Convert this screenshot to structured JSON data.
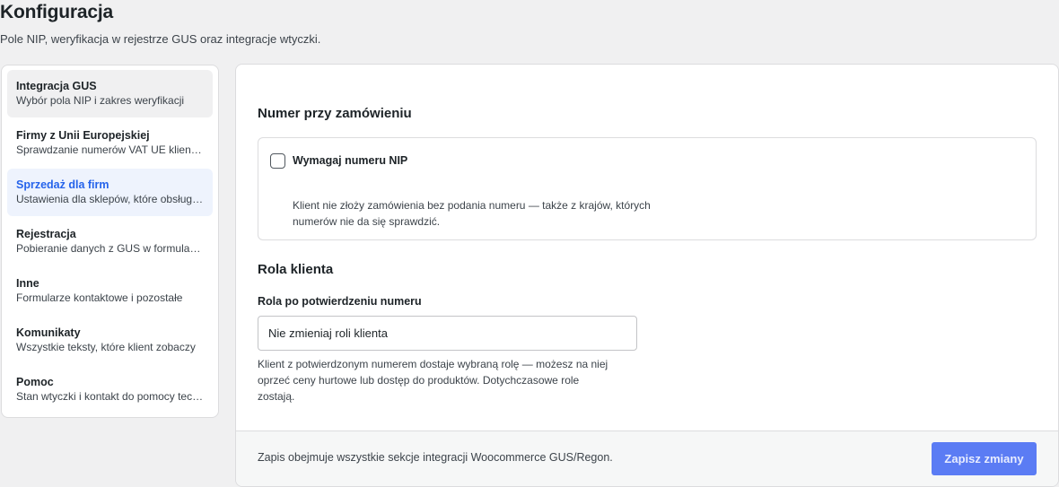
{
  "header": {
    "title": "Konfiguracja",
    "subtitle": "Pole NIP, weryfikacja w rejestrze GUS oraz integracje wtyczki."
  },
  "sidebar": {
    "items": [
      {
        "label": "Integracja GUS",
        "desc": "Wybór pola NIP i zakres weryfikacji"
      },
      {
        "label": "Firmy z Unii Europejskiej",
        "desc": "Sprawdzanie numerów VAT UE klientów"
      },
      {
        "label": "Sprzedaż dla firm",
        "desc": "Ustawienia dla sklepów, które obsługują"
      },
      {
        "label": "Rejestracja",
        "desc": "Pobieranie danych z GUS w formularzu"
      },
      {
        "label": "Inne",
        "desc": "Formularze kontaktowe i pozostałe"
      },
      {
        "label": "Komunikaty",
        "desc": "Wszystkie teksty, które klient zobaczy"
      },
      {
        "label": "Pomoc",
        "desc": "Stan wtyczki i kontakt do pomocy technicznej"
      }
    ],
    "active_index": 2
  },
  "main": {
    "order_section": {
      "title": "Numer przy zamówieniu",
      "checkbox_label": "Wymagaj numeru NIP",
      "checked": false,
      "help": "Klient nie złoży zamówienia bez podania numeru — także z krajów, których numerów nie da się sprawdzić."
    },
    "role_section": {
      "title": "Rola klienta",
      "field_label": "Rola po potwierdzeniu numeru",
      "select_value": "Nie zmieniaj roli klienta",
      "help": "Klient z potwierdzonym numerem dostaje wybraną rolę — możesz na niej oprzeć ceny hurtowe lub dostęp do produktów. Dotychczasowe role zostają."
    }
  },
  "footer": {
    "note": "Zapis obejmuje wszystkie sekcje integracji Woocommerce GUS/Regon.",
    "save_label": "Zapisz zmiany"
  },
  "colors": {
    "accent": "#2563eb",
    "button": "#5b7cf4"
  }
}
